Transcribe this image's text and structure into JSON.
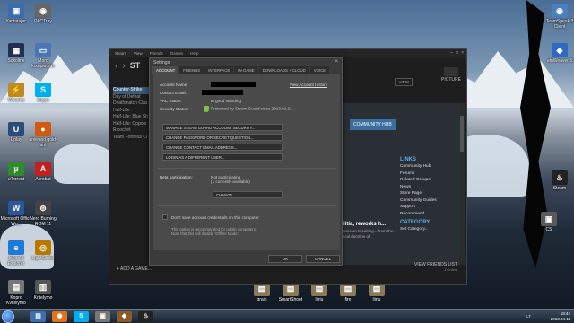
{
  "desktop": {
    "icons_left": [
      {
        "label": "Yantatajac",
        "glyph": "▣",
        "color": "#3b6bb0",
        "icon": "folder-icon"
      },
      {
        "label": "PACTray",
        "glyph": "◉",
        "color": "#666",
        "icon": "webcam-icon"
      },
      {
        "label": "Sokoline",
        "glyph": "▦",
        "color": "#203050",
        "icon": "computer-icon"
      },
      {
        "label": "Moro kompiuteris",
        "glyph": "▭",
        "color": "#4a76b5",
        "icon": "computer-icon"
      },
      {
        "label": "Winamp",
        "glyph": "⚡",
        "color": "#c08a20",
        "icon": "winamp-icon"
      },
      {
        "label": "Skype",
        "glyph": "S",
        "color": "#00aff0",
        "icon": "skype-icon"
      },
      {
        "label": "Uplay",
        "glyph": "U",
        "color": "#2c4d7a",
        "icon": "game-icon"
      },
      {
        "label": "aniwand gold-ant",
        "glyph": "●",
        "color": "#d05a10",
        "icon": "app-icon"
      },
      {
        "label": "uTorrent",
        "glyph": "µ",
        "color": "#2e8b2e",
        "icon": "utorrent-icon"
      },
      {
        "label": "Acrobat",
        "glyph": "A",
        "color": "#c21f1f",
        "icon": "acrobat-icon"
      },
      {
        "label": "Microsoft Office Wo...",
        "glyph": "W",
        "color": "#2b579a",
        "icon": "word-icon"
      },
      {
        "label": "Nero Burning ROM 11",
        "glyph": "⊚",
        "color": "#444",
        "icon": "nero-icon"
      },
      {
        "label": "Internet Explorer",
        "glyph": "e",
        "color": "#1e7ad6",
        "icon": "ie-icon"
      },
      {
        "label": "LightScribe",
        "glyph": "◎",
        "color": "#b77a00",
        "icon": "app-icon"
      },
      {
        "label": "Kopro Kvitelymo",
        "glyph": "▤",
        "color": "#777",
        "icon": "app-icon"
      },
      {
        "label": "Kritelymo",
        "glyph": "▥",
        "color": "#555",
        "icon": "app-icon"
      }
    ],
    "icons_right": [
      {
        "label": "TeamSpeak 3 Client",
        "glyph": "◉",
        "color": "#4c7fc0",
        "icon": "teamspeak-icon"
      },
      {
        "label": "amWeaver 5",
        "glyph": "◆",
        "color": "#2c6bc1",
        "icon": "app-icon"
      },
      {
        "label": "Steam",
        "glyph": "♨",
        "color": "#222",
        "icon": "steam-icon"
      },
      {
        "label": "CS",
        "glyph": "▣",
        "color": "#5a5a5a",
        "icon": "game-icon"
      }
    ],
    "bottom_files": [
      "grain",
      "SmartShoot",
      "liiriu",
      "fire",
      "liiriu"
    ]
  },
  "steam": {
    "menu": [
      "Steam",
      "View",
      "Friends",
      "Games",
      "Help"
    ],
    "store_label": "ST",
    "picture_label": "PICTURE",
    "view_label": "VIEW",
    "sidebar_items": [
      "Counter-Strike",
      "Day of Defeat",
      "Deathmatch Clas",
      "Half-Life",
      "Half-Life: Blue Sh",
      "Half-Life: Opposi",
      "Ricochet",
      "Team Fortress Cl"
    ],
    "community_hub": "COMMUNITY HUB",
    "links_title": "LINKS",
    "links": [
      "Community Hub",
      "Forums",
      "Related Groups",
      "News",
      "Store Page",
      "Community Guides",
      "Support",
      "Recommend..."
    ],
    "category_title": "CATEGORY",
    "category_item": "Set Category...",
    "news_title": "militia, reworks h...",
    "news_body": "focuses on tweaking... from the... tactical doctrine of",
    "add_game": "+ ADD A GAME...",
    "view_friends": "VIEW FRIENDS LIST",
    "friends_online": "1 Online"
  },
  "settings": {
    "title": "Settings",
    "tabs": [
      "ACCOUNT",
      "FRIENDS",
      "INTERFACE",
      "IN-GAME",
      "DOWNLOADS + CLOUD",
      "VOICE"
    ],
    "account_name_label": "Account Name:",
    "contact_email_label": "Contact Email:",
    "vac_label": "VAC Status:",
    "vac_value": "In good standing",
    "security_label": "Security Status:",
    "security_value": "Protected by Steam Guard since 2013.01.31",
    "view_history": "View Account History",
    "buttons": [
      "MANAGE STEAM GUARD ACCOUNT SECURITY...",
      "CHANGE PASSWORD OR SECRET QUESTION...",
      "CHANGE CONTACT EMAIL ADDRESS...",
      "LOGIN AS A DIFFERENT USER..."
    ],
    "beta_label": "Beta participation:",
    "beta_value_1": "Not participating",
    "beta_value_2": "(1 currently available)",
    "change_button": "CHANGE...",
    "dont_save_label": "Don't save account credentials on this computer",
    "note_line_1": "This option is recommended for public computers.",
    "note_line_2": "Note that this will disable 'Offline Mode'.",
    "ok": "OK",
    "cancel": "CANCEL"
  },
  "taskbar": {
    "apps": [
      {
        "glyph": "▤",
        "color": "#3e6eae",
        "icon": "explorer-icon"
      },
      {
        "glyph": "◉",
        "color": "#e2731b",
        "icon": "firefox-icon"
      },
      {
        "glyph": "S",
        "color": "#00aff0",
        "icon": "skype-icon"
      },
      {
        "glyph": "▣",
        "color": "#777",
        "icon": "app-icon"
      },
      {
        "glyph": "◆",
        "color": "#8a5a2a",
        "icon": "app-icon"
      },
      {
        "glyph": "♨",
        "color": "#222",
        "icon": "steam-icon"
      }
    ],
    "lang": "LT",
    "time": "18:44",
    "date": "2013.04.11"
  }
}
